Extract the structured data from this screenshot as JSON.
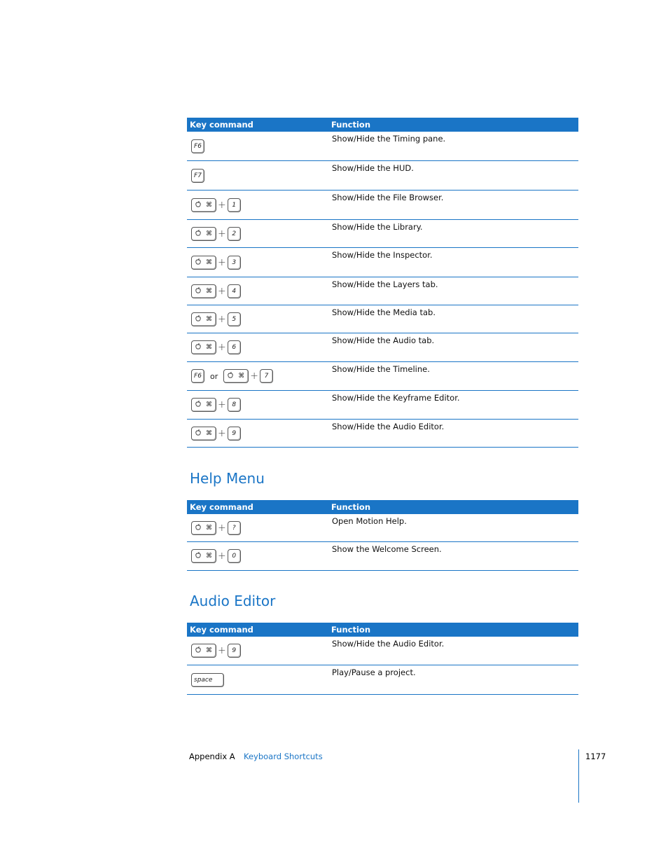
{
  "headers": {
    "key": "Key command",
    "function": "Function"
  },
  "table1": [
    {
      "keys": [
        {
          "type": "single",
          "label": "F6"
        }
      ],
      "function": "Show/Hide the Timing pane."
    },
    {
      "keys": [
        {
          "type": "single",
          "label": "F7"
        }
      ],
      "function": "Show/Hide the HUD."
    },
    {
      "keys": [
        {
          "type": "mod"
        },
        {
          "type": "plus"
        },
        {
          "type": "single",
          "label": "1"
        }
      ],
      "function": "Show/Hide the File Browser."
    },
    {
      "keys": [
        {
          "type": "mod"
        },
        {
          "type": "plus"
        },
        {
          "type": "single",
          "label": "2"
        }
      ],
      "function": "Show/Hide the Library."
    },
    {
      "keys": [
        {
          "type": "mod"
        },
        {
          "type": "plus"
        },
        {
          "type": "single",
          "label": "3"
        }
      ],
      "function": "Show/Hide the Inspector."
    },
    {
      "keys": [
        {
          "type": "mod"
        },
        {
          "type": "plus"
        },
        {
          "type": "single",
          "label": "4"
        }
      ],
      "function": "Show/Hide the Layers tab."
    },
    {
      "keys": [
        {
          "type": "mod"
        },
        {
          "type": "plus"
        },
        {
          "type": "single",
          "label": "5"
        }
      ],
      "function": "Show/Hide the Media tab."
    },
    {
      "keys": [
        {
          "type": "mod"
        },
        {
          "type": "plus"
        },
        {
          "type": "single",
          "label": "6"
        }
      ],
      "function": "Show/Hide the Audio tab."
    },
    {
      "keys": [
        {
          "type": "single",
          "label": "F6"
        },
        {
          "type": "or",
          "label": "or"
        },
        {
          "type": "mod"
        },
        {
          "type": "plus"
        },
        {
          "type": "single",
          "label": "7"
        }
      ],
      "function": "Show/Hide the Timeline."
    },
    {
      "keys": [
        {
          "type": "mod"
        },
        {
          "type": "plus"
        },
        {
          "type": "single",
          "label": "8"
        }
      ],
      "function": "Show/Hide the Keyframe Editor."
    },
    {
      "keys": [
        {
          "type": "mod"
        },
        {
          "type": "plus"
        },
        {
          "type": "single",
          "label": "9"
        }
      ],
      "function": "Show/Hide the Audio Editor."
    }
  ],
  "help_menu": {
    "title": "Help Menu",
    "rows": [
      {
        "keys": [
          {
            "type": "mod"
          },
          {
            "type": "plus"
          },
          {
            "type": "single",
            "label": "?"
          }
        ],
        "function": "Open Motion Help."
      },
      {
        "keys": [
          {
            "type": "mod"
          },
          {
            "type": "plus"
          },
          {
            "type": "single",
            "label": "0"
          }
        ],
        "function": "Show the Welcome Screen."
      }
    ]
  },
  "audio_editor": {
    "title": "Audio Editor",
    "rows": [
      {
        "keys": [
          {
            "type": "mod"
          },
          {
            "type": "plus"
          },
          {
            "type": "single",
            "label": "9"
          }
        ],
        "function": "Show/Hide the Audio Editor."
      },
      {
        "keys": [
          {
            "type": "space",
            "label": "space"
          }
        ],
        "function": "Play/Pause a project."
      }
    ]
  },
  "modifier": {
    "apple": "",
    "apple_fallback": "̷",
    "command": "⌘"
  },
  "footer": {
    "label": "Appendix A",
    "link": "Keyboard Shortcuts",
    "page": "1177"
  }
}
